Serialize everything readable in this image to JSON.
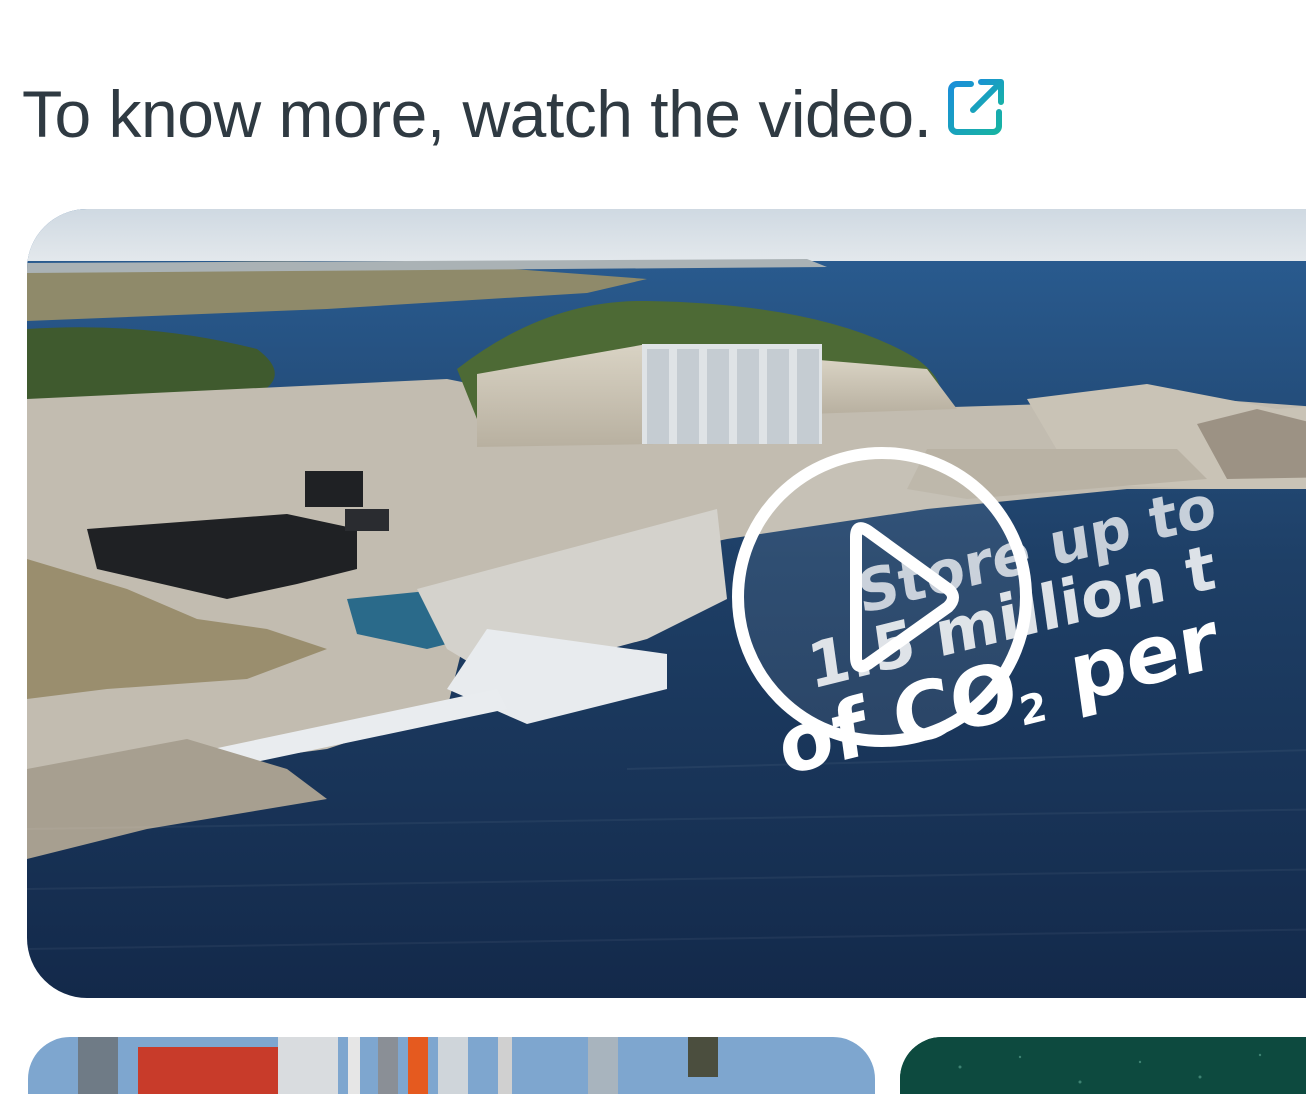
{
  "heading": {
    "text": "To know more, watch the video.",
    "icon": "external-link-icon"
  },
  "video": {
    "play_icon": "play-icon",
    "overlay_line1": "Store up to",
    "overlay_line2": "1.5 million t",
    "overlay_line3_main": "of CO",
    "overlay_line3_sub": "2",
    "overlay_line3_end": " per"
  },
  "colors": {
    "heading_text": "#2f3a42",
    "icon_gradient_start": "#1a8fd8",
    "icon_gradient_end": "#17b3a3",
    "sea": "#1e3f66",
    "thumb_right_bg": "#0d4a3f"
  }
}
